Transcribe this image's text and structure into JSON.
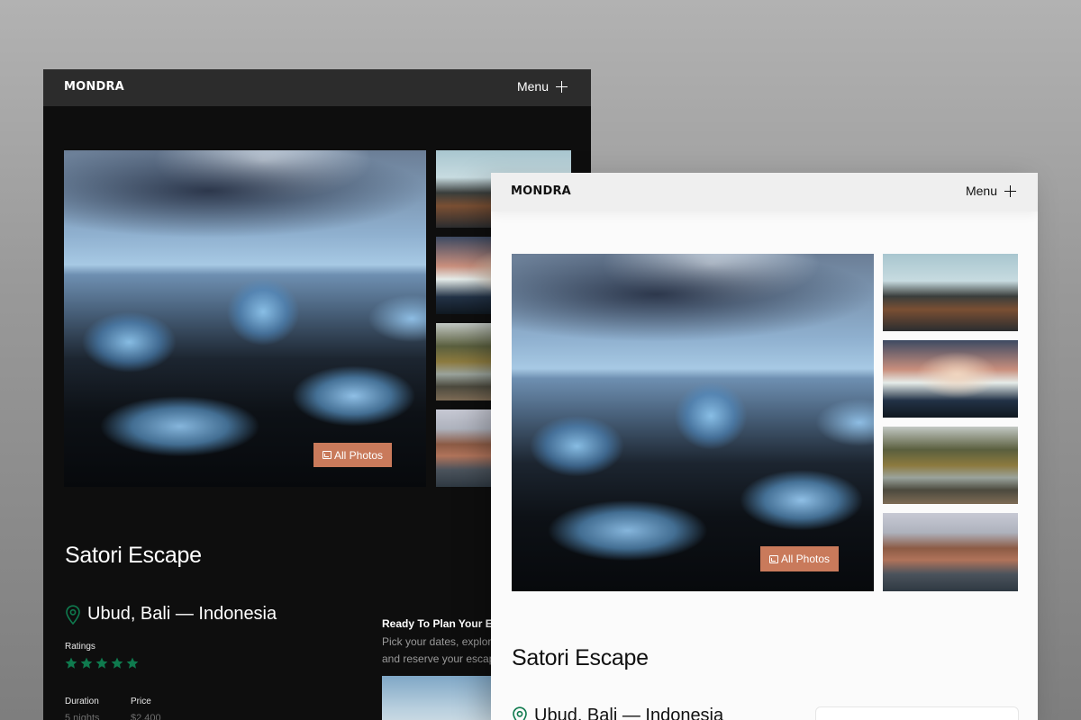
{
  "brand": "MONDRA",
  "nav": {
    "menu_label": "Menu"
  },
  "gallery": {
    "all_photos_label": "All Photos"
  },
  "listing": {
    "title": "Satori Escape",
    "location": "Ubud, Bali — Indonesia",
    "ratings_label": "Ratings",
    "rating_stars": 5,
    "duration_label": "Duration",
    "duration_value": "5 nights",
    "price_label": "Price",
    "price_value": "$2,400"
  },
  "plan": {
    "title": "Ready To Plan Your Esc",
    "text_line1": "Pick your dates, explor",
    "text_line2": "and reserve your escap"
  },
  "colors": {
    "accent": "#c97a5b",
    "star_green": "#0f7a4e",
    "dark_bg": "#0e0e0e",
    "light_bg": "#fbfbfb"
  },
  "icons": [
    "plus-icon",
    "photos-icon",
    "map-pin-icon",
    "star-icon"
  ]
}
